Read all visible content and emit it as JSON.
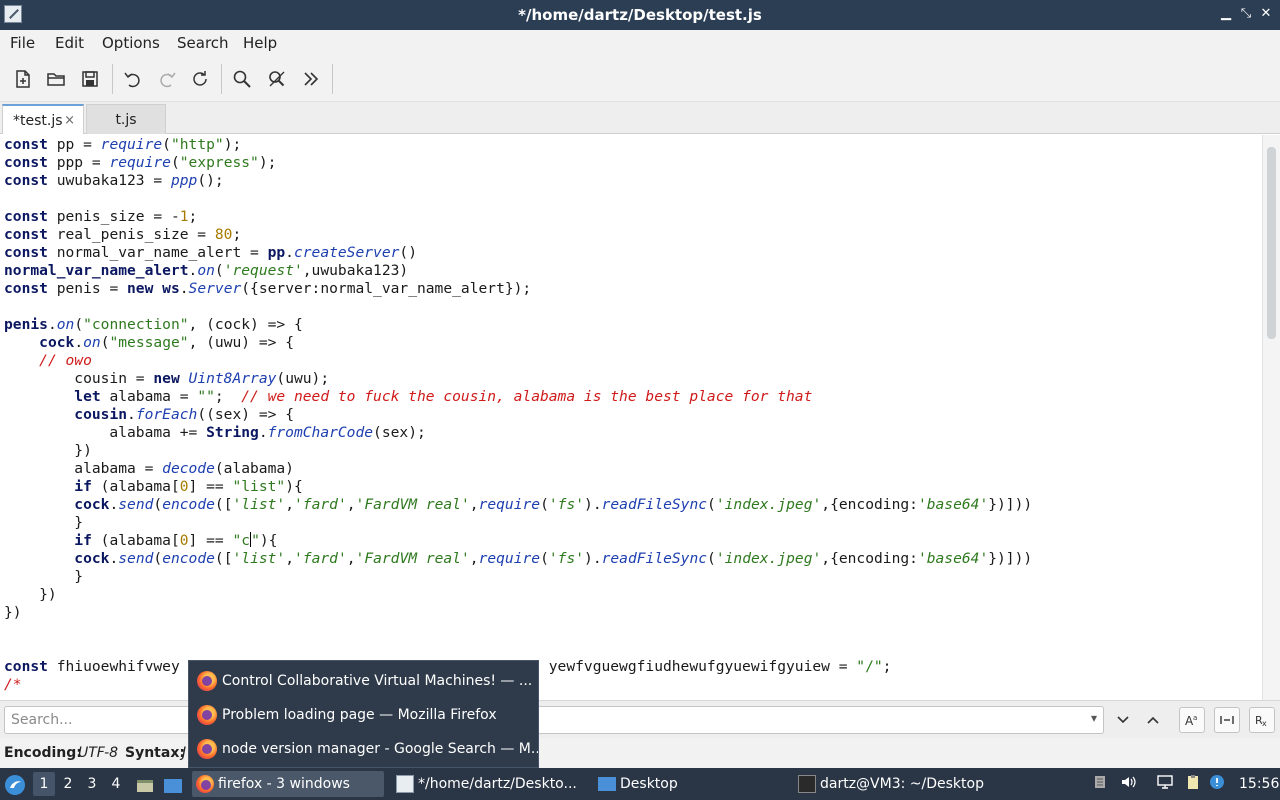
{
  "window": {
    "title": "*/home/dartz/Desktop/test.js"
  },
  "menu": [
    "File",
    "Edit",
    "Options",
    "Search",
    "Help"
  ],
  "tabs": [
    {
      "label": "*test.js",
      "close": "×"
    },
    {
      "label": "t.js"
    }
  ],
  "code": {
    "lines": [
      [
        {
          "t": "const",
          "c": "kw"
        },
        {
          "t": " pp = "
        },
        {
          "t": "require",
          "c": "fn"
        },
        {
          "t": "("
        },
        {
          "t": "\"http\"",
          "c": "str"
        },
        {
          "t": ");"
        }
      ],
      [
        {
          "t": "const",
          "c": "kw"
        },
        {
          "t": " ppp = "
        },
        {
          "t": "require",
          "c": "fn"
        },
        {
          "t": "("
        },
        {
          "t": "\"express\"",
          "c": "str"
        },
        {
          "t": ");"
        }
      ],
      [
        {
          "t": "const",
          "c": "kw"
        },
        {
          "t": " uwubaka123 = "
        },
        {
          "t": "ppp",
          "c": "fn"
        },
        {
          "t": "();"
        }
      ],
      [],
      [
        {
          "t": "const",
          "c": "kw"
        },
        {
          "t": " penis_size = -"
        },
        {
          "t": "1",
          "c": "num"
        },
        {
          "t": ";"
        }
      ],
      [
        {
          "t": "const",
          "c": "kw"
        },
        {
          "t": " real_penis_size = "
        },
        {
          "t": "80",
          "c": "num"
        },
        {
          "t": ";"
        }
      ],
      [
        {
          "t": "const",
          "c": "kw"
        },
        {
          "t": " normal_var_name_alert = "
        },
        {
          "t": "pp",
          "c": "obj"
        },
        {
          "t": "."
        },
        {
          "t": "createServer",
          "c": "fn"
        },
        {
          "t": "()"
        }
      ],
      [
        {
          "t": "normal_var_name_alert",
          "c": "obj"
        },
        {
          "t": "."
        },
        {
          "t": "on",
          "c": "fn"
        },
        {
          "t": "("
        },
        {
          "t": "'request'",
          "c": "sstr"
        },
        {
          "t": ",uwubaka123)"
        }
      ],
      [
        {
          "t": "const",
          "c": "kw"
        },
        {
          "t": " penis = "
        },
        {
          "t": "new",
          "c": "kw"
        },
        {
          "t": " "
        },
        {
          "t": "ws",
          "c": "obj"
        },
        {
          "t": "."
        },
        {
          "t": "Server",
          "c": "fn"
        },
        {
          "t": "({server:normal_var_name_alert});"
        }
      ],
      [],
      [
        {
          "t": "penis",
          "c": "obj"
        },
        {
          "t": "."
        },
        {
          "t": "on",
          "c": "fn"
        },
        {
          "t": "("
        },
        {
          "t": "\"connection\"",
          "c": "str"
        },
        {
          "t": ", (cock) => {"
        }
      ],
      [
        {
          "t": "    "
        },
        {
          "t": "cock",
          "c": "obj"
        },
        {
          "t": "."
        },
        {
          "t": "on",
          "c": "fn"
        },
        {
          "t": "("
        },
        {
          "t": "\"message\"",
          "c": "str"
        },
        {
          "t": ", (uwu) => {"
        }
      ],
      [
        {
          "t": "    "
        },
        {
          "t": "// owo",
          "c": "cmt"
        }
      ],
      [
        {
          "t": "        cousin = "
        },
        {
          "t": "new",
          "c": "kw"
        },
        {
          "t": " "
        },
        {
          "t": "Uint8Array",
          "c": "fn"
        },
        {
          "t": "(uwu);"
        }
      ],
      [
        {
          "t": "        "
        },
        {
          "t": "let",
          "c": "kw"
        },
        {
          "t": " alabama = "
        },
        {
          "t": "\"\"",
          "c": "str"
        },
        {
          "t": ";  "
        },
        {
          "t": "// we need to fuck the cousin, alabama is the best place for that",
          "c": "cmt"
        }
      ],
      [
        {
          "t": "        "
        },
        {
          "t": "cousin",
          "c": "obj"
        },
        {
          "t": "."
        },
        {
          "t": "forEach",
          "c": "fn"
        },
        {
          "t": "((sex) => {"
        }
      ],
      [
        {
          "t": "            alabama += "
        },
        {
          "t": "String",
          "c": "obj"
        },
        {
          "t": "."
        },
        {
          "t": "fromCharCode",
          "c": "fn"
        },
        {
          "t": "(sex);"
        }
      ],
      [
        {
          "t": "        })"
        }
      ],
      [
        {
          "t": "        alabama = "
        },
        {
          "t": "decode",
          "c": "fn"
        },
        {
          "t": "(alabama)"
        }
      ],
      [
        {
          "t": "        "
        },
        {
          "t": "if",
          "c": "kw"
        },
        {
          "t": " (alabama["
        },
        {
          "t": "0",
          "c": "num"
        },
        {
          "t": "] == "
        },
        {
          "t": "\"list\"",
          "c": "str"
        },
        {
          "t": "){"
        }
      ],
      [
        {
          "t": "        "
        },
        {
          "t": "cock",
          "c": "obj"
        },
        {
          "t": "."
        },
        {
          "t": "send",
          "c": "fn"
        },
        {
          "t": "("
        },
        {
          "t": "encode",
          "c": "fn"
        },
        {
          "t": "(["
        },
        {
          "t": "'list'",
          "c": "sstr"
        },
        {
          "t": ","
        },
        {
          "t": "'fard'",
          "c": "sstr"
        },
        {
          "t": ","
        },
        {
          "t": "'FardVM real'",
          "c": "sstr"
        },
        {
          "t": ","
        },
        {
          "t": "require",
          "c": "fn"
        },
        {
          "t": "("
        },
        {
          "t": "'fs'",
          "c": "sstr"
        },
        {
          "t": ")."
        },
        {
          "t": "readFileSync",
          "c": "fn"
        },
        {
          "t": "("
        },
        {
          "t": "'index.jpeg'",
          "c": "sstr"
        },
        {
          "t": ",{encoding:"
        },
        {
          "t": "'base64'",
          "c": "sstr"
        },
        {
          "t": "})]))"
        }
      ],
      [
        {
          "t": "        }"
        }
      ],
      [
        {
          "t": "        "
        },
        {
          "t": "if",
          "c": "kw"
        },
        {
          "t": " (alabama["
        },
        {
          "t": "0",
          "c": "num"
        },
        {
          "t": "] == "
        },
        {
          "t": "\"c",
          "c": "str"
        },
        {
          "t": "",
          "c": "caret"
        },
        {
          "t": "\"",
          "c": "str"
        },
        {
          "t": "){"
        }
      ],
      [
        {
          "t": "        "
        },
        {
          "t": "cock",
          "c": "obj"
        },
        {
          "t": "."
        },
        {
          "t": "send",
          "c": "fn"
        },
        {
          "t": "("
        },
        {
          "t": "encode",
          "c": "fn"
        },
        {
          "t": "(["
        },
        {
          "t": "'list'",
          "c": "sstr"
        },
        {
          "t": ","
        },
        {
          "t": "'fard'",
          "c": "sstr"
        },
        {
          "t": ","
        },
        {
          "t": "'FardVM real'",
          "c": "sstr"
        },
        {
          "t": ","
        },
        {
          "t": "require",
          "c": "fn"
        },
        {
          "t": "("
        },
        {
          "t": "'fs'",
          "c": "sstr"
        },
        {
          "t": ")."
        },
        {
          "t": "readFileSync",
          "c": "fn"
        },
        {
          "t": "("
        },
        {
          "t": "'index.jpeg'",
          "c": "sstr"
        },
        {
          "t": ",{encoding:"
        },
        {
          "t": "'base64'",
          "c": "sstr"
        },
        {
          "t": "})]))"
        }
      ],
      [
        {
          "t": "        }"
        }
      ],
      [
        {
          "t": "    })"
        }
      ],
      [
        {
          "t": "})"
        }
      ],
      [],
      [],
      [
        {
          "t": "const",
          "c": "kw"
        },
        {
          "t": " fhiuoewhifvwey"
        },
        {
          "t": "                                          "
        },
        {
          "t": "yewfvguewgfiudhewufgyuewifgyuiew = "
        },
        {
          "t": "\"/\"",
          "c": "str"
        },
        {
          "t": ";"
        }
      ],
      [
        {
          "t": "/*",
          "c": "cmt"
        }
      ]
    ]
  },
  "search": {
    "placeholder": "Search...",
    "dropdown": "▾"
  },
  "status": {
    "encoding_label": "Encoding:",
    "encoding_value": "UTF-8",
    "syntax_label": "Syntax:",
    "syntax_value": "J"
  },
  "popup": {
    "items": [
      "Control Collaborative Virtual Machines! — ...",
      "Problem loading page — Mozilla Firefox",
      "node version manager - Google Search — M..."
    ]
  },
  "taskbar": {
    "workspaces": [
      "1",
      "2",
      "3",
      "4"
    ],
    "tasks": [
      {
        "label": "firefox - 3 windows"
      },
      {
        "label": "*/home/dartz/Deskto..."
      },
      {
        "label": "Desktop"
      },
      {
        "label": "dartz@VM3: ~/Desktop"
      }
    ],
    "clock": "15:56"
  },
  "colors": {
    "titlebar": "#2c3e54",
    "taskbar": "#2a3545",
    "keyword": "#0b1760",
    "function": "#1e3fb0",
    "string": "#2f7a1f",
    "comment": "#d01b1b",
    "number": "#a67a00"
  }
}
